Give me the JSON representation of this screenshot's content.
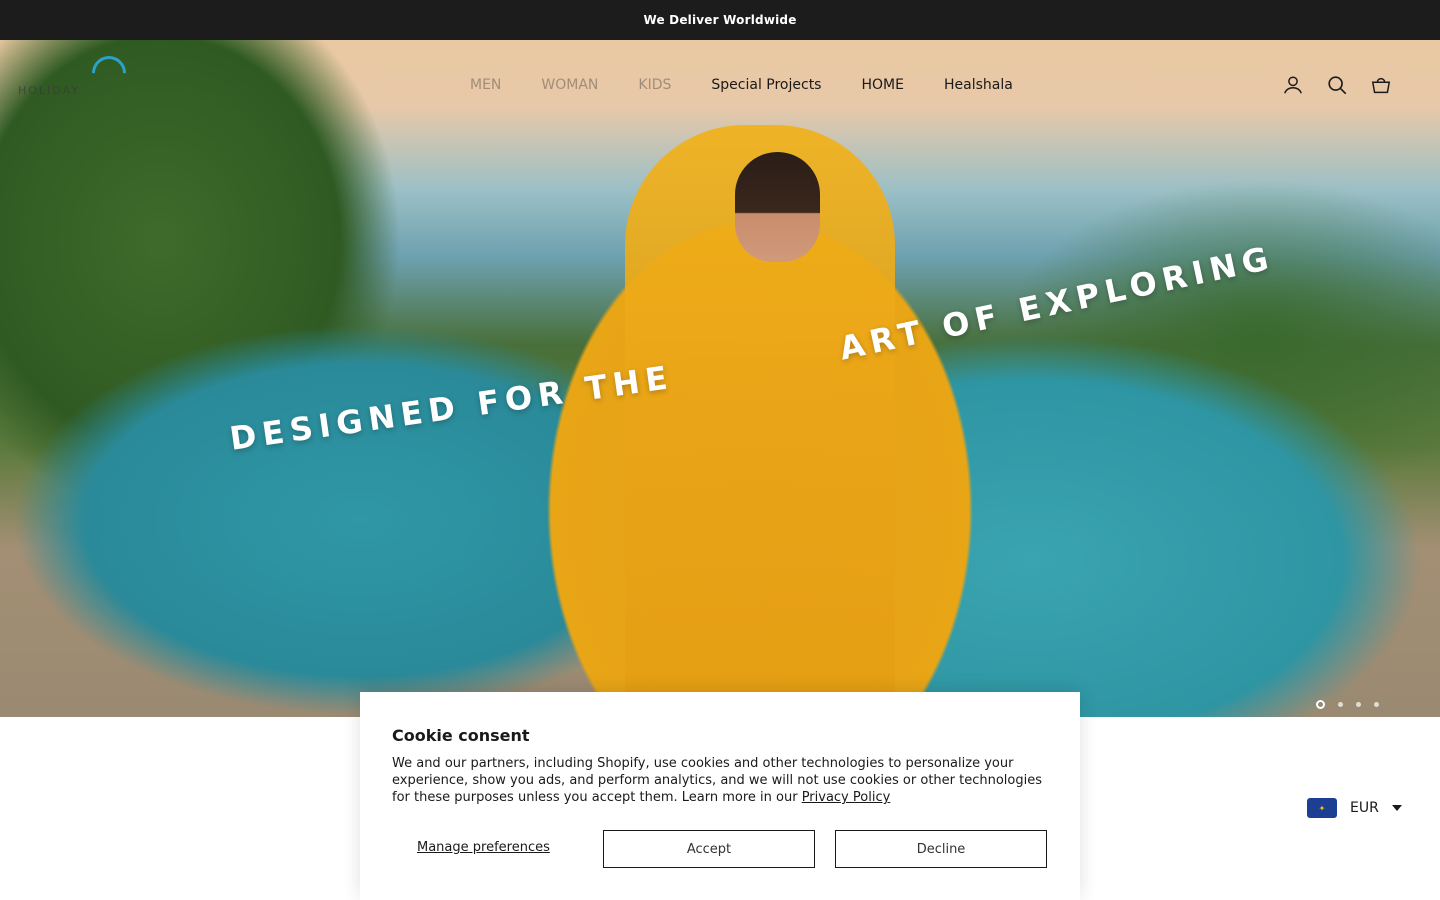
{
  "announcement": {
    "text": "We Deliver Worldwide"
  },
  "header": {
    "logo_text": "HOLIDAY",
    "nav": [
      "MEN",
      "WOMAN",
      "KIDS",
      "Special Projects",
      "HOME",
      "Healshala"
    ],
    "icons": [
      "account-icon",
      "search-icon",
      "cart-icon"
    ]
  },
  "hero": {
    "headline_left": "DESIGNED FOR THE",
    "headline_right": "ART OF EXPLORING",
    "slides": 4,
    "active_slide": 1
  },
  "cookie": {
    "title": "Cookie consent",
    "body": "We and our partners, including Shopify, use cookies and other technologies to personalize your experience, show you ads, and perform analytics, and we will not use cookies or other technologies for these purposes unless you accept them. Learn more in our ",
    "link": "Privacy Policy",
    "manage": "Manage preferences",
    "accept": "Accept",
    "decline": "Decline"
  },
  "currency": {
    "code": "EUR",
    "flag": "eu-flag-icon"
  },
  "colors": {
    "announcement_bg": "#1c1c1c",
    "logo_accent": "#2aa3c8",
    "flag_blue": "#1c3f94"
  }
}
